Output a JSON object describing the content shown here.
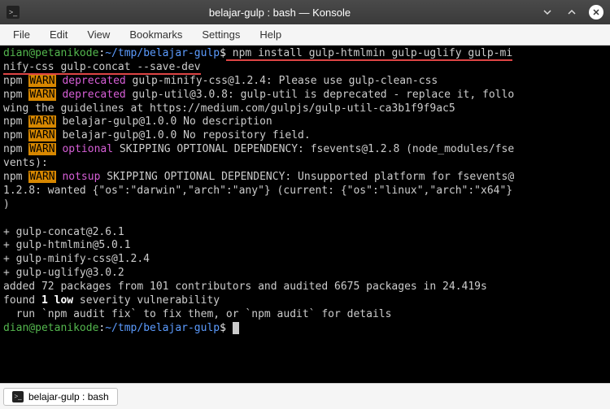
{
  "window": {
    "title": "belajar-gulp : bash — Konsole",
    "icon_glyph": ">_"
  },
  "menu": {
    "file": "File",
    "edit": "Edit",
    "view": "View",
    "bookmarks": "Bookmarks",
    "settings": "Settings",
    "help": "Help"
  },
  "prompt": {
    "user_host": "dian@petanikode",
    "sep": ":",
    "path": "~/tmp/belajar-gulp",
    "dollar": "$"
  },
  "command": {
    "line1": " npm install gulp-htmlmin gulp-uglify gulp-mi",
    "line2": "nify-css gulp-concat --save-dev"
  },
  "out": {
    "l1a": "npm ",
    "l1_warn": "WARN",
    "l1b": " ",
    "l1_dep": "deprecated",
    "l1c": " gulp-minify-css@1.2.4: Please use gulp-clean-css",
    "l2a": "npm ",
    "l2_warn": "WARN",
    "l2b": " ",
    "l2_dep": "deprecated",
    "l2c": " gulp-util@3.0.8: gulp-util is deprecated - replace it, follo",
    "l3": "wing the guidelines at https://medium.com/gulpjs/gulp-util-ca3b1f9f9ac5",
    "l4a": "npm ",
    "l4_warn": "WARN",
    "l4b": " belajar-gulp@1.0.0 No description",
    "l5a": "npm ",
    "l5_warn": "WARN",
    "l5b": " belajar-gulp@1.0.0 No repository field.",
    "l6a": "npm ",
    "l6_warn": "WARN",
    "l6b": " ",
    "l6_opt": "optional",
    "l6c": " SKIPPING OPTIONAL DEPENDENCY: fsevents@1.2.8 (node_modules/fse",
    "l7": "vents):",
    "l8a": "npm ",
    "l8_warn": "WARN",
    "l8b": " ",
    "l8_ns": "notsup",
    "l8c": " SKIPPING OPTIONAL DEPENDENCY: Unsupported platform for fsevents@",
    "l9": "1.2.8: wanted {\"os\":\"darwin\",\"arch\":\"any\"} (current: {\"os\":\"linux\",\"arch\":\"x64\"}",
    "l10": ")",
    "blank": "",
    "p1": "+ gulp-concat@2.6.1",
    "p2": "+ gulp-htmlmin@5.0.1",
    "p3": "+ gulp-minify-css@1.2.4",
    "p4": "+ gulp-uglify@3.0.2",
    "summary": "added 72 packages from 101 contributors and audited 6675 packages in 24.419s",
    "vuln_a": "found ",
    "vuln_b": "1",
    "vuln_c": " ",
    "vuln_d": "low",
    "vuln_e": " severity vulnerability",
    "fix": "  run `npm audit fix` to fix them, or `npm audit` for details"
  },
  "tab": {
    "label": "belajar-gulp : bash",
    "icon_glyph": ">_"
  }
}
